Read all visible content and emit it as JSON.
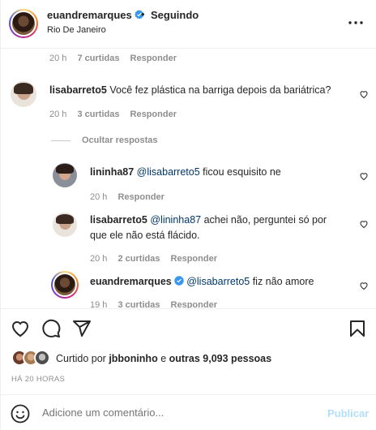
{
  "header": {
    "username": "euandremarques",
    "separator": "•",
    "follow_status": "Seguindo",
    "location": "Rio De Janeiro"
  },
  "comments": [
    {
      "time": "20 h",
      "likes": "7 curtidas",
      "reply": "Responder"
    },
    {
      "username": "lisabarreto5",
      "text": "Você fez plástica na barriga depois da bariátrica?",
      "time": "20 h",
      "likes": "3 curtidas",
      "reply": "Responder"
    }
  ],
  "hide_replies": "Ocultar respostas",
  "replies": [
    {
      "username": "lininha87",
      "mention": "@lisabarreto5",
      "text": " ficou esquisito ne",
      "time": "20 h",
      "reply": "Responder"
    },
    {
      "username": "lisabarreto5",
      "mention": "@lininha87",
      "text": " achei não, perguntei só por",
      "text2": "que ele não está flácido.",
      "time": "20 h",
      "likes": "2 curtidas",
      "reply": "Responder"
    },
    {
      "username": "euandremarques",
      "mention": "@lisabarreto5",
      "text": " fiz não amore",
      "time": "19 h",
      "likes": "3 curtidas",
      "reply": "Responder"
    }
  ],
  "likes_summary": {
    "prefix": "Curtido por ",
    "user": "jbboninho",
    "middle": " e ",
    "others": "outras 9,093 pessoas"
  },
  "post_time": "HÁ 20 HORAS",
  "compose": {
    "placeholder": "Adicione um comentário...",
    "post_label": "Publicar"
  },
  "colors": {
    "verified": "#3897f0",
    "mention": "#00376b",
    "post_disabled": "#b2dffc",
    "muted": "#8e8e8e"
  }
}
